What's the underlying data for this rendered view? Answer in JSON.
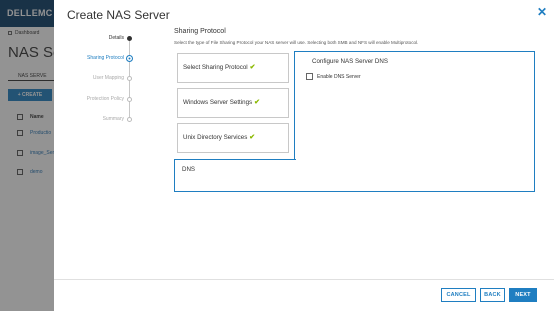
{
  "background": {
    "brand": "DELLEMC",
    "breadcrumb": "Dashboard",
    "page_title": "NAS Ser",
    "tab": "NAS SERVE",
    "create_label": "+ CREATE",
    "list_header": "Name",
    "rows": [
      "Productio",
      "image_Ser",
      "demo"
    ]
  },
  "modal": {
    "title": "Create NAS Server",
    "close_icon": "close-icon"
  },
  "steps": [
    {
      "label": "Details",
      "state": "done"
    },
    {
      "label": "Sharing Protocol",
      "state": "active"
    },
    {
      "label": "User Mapping",
      "state": "pending"
    },
    {
      "label": "Protection Policy",
      "state": "pending"
    },
    {
      "label": "Summary",
      "state": "pending"
    }
  ],
  "main": {
    "section_title": "Sharing Protocol",
    "section_desc": "Select the type of File Sharing Protocol your NAS server will use. Selecting both SMB and NFS will enable Multiprotocol.",
    "options": [
      {
        "label": "Select Sharing Protocol",
        "checked": true
      },
      {
        "label": "Windows Server Settings",
        "checked": true
      },
      {
        "label": "Unix Directory Services",
        "checked": true
      },
      {
        "label": "DNS",
        "checked": false
      }
    ],
    "check_glyph": "✔"
  },
  "dns_panel": {
    "title": "Configure NAS Server DNS",
    "enable_dns_label": "Enable DNS Server",
    "enable_dns_checked": false
  },
  "footer": {
    "cancel_label": "CANCEL",
    "back_label": "BACK",
    "next_label": "NEXT"
  },
  "colors": {
    "accent": "#1f7ec1",
    "check": "#8ab800",
    "brand_bar": "#0a3c66"
  }
}
